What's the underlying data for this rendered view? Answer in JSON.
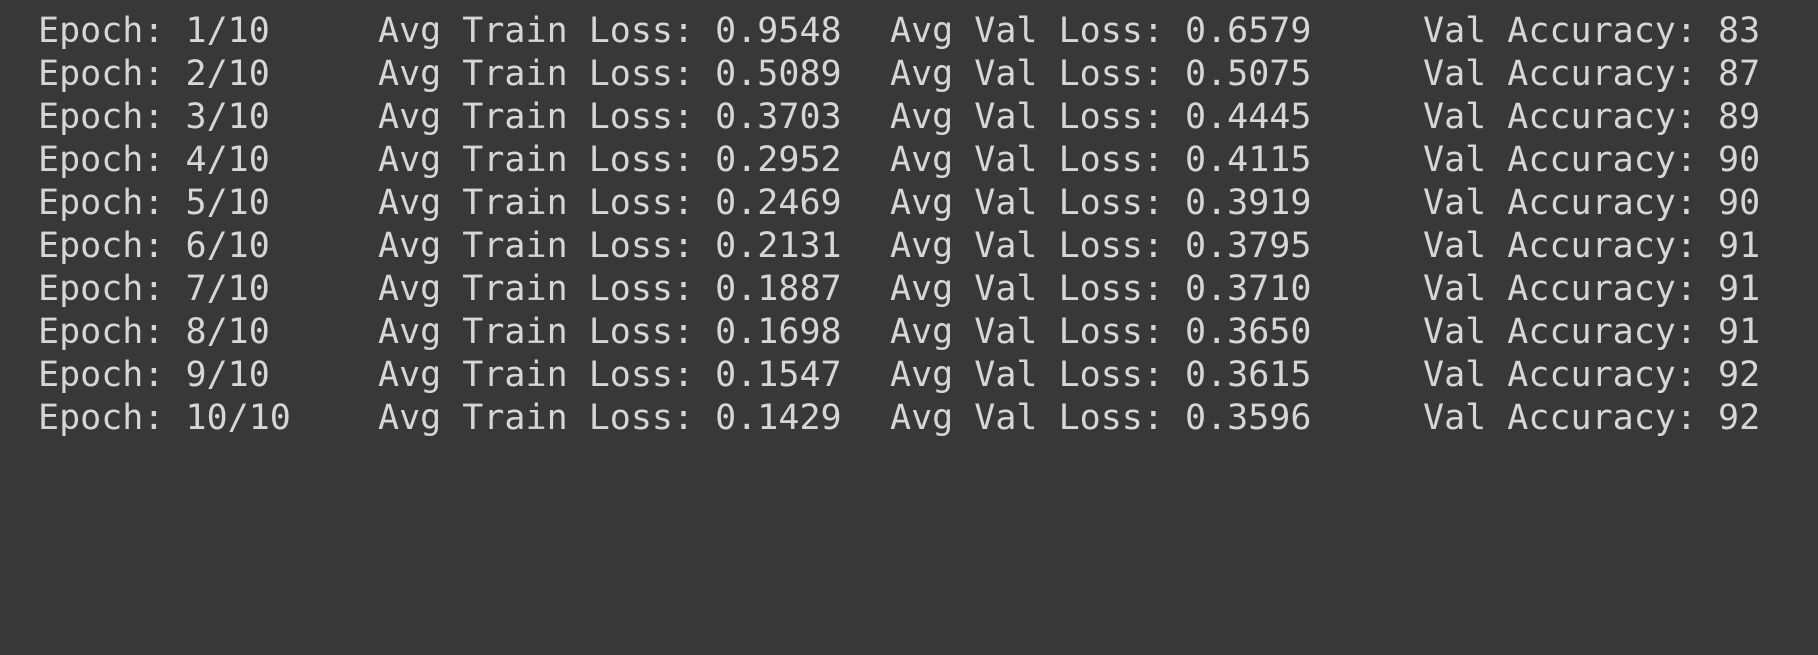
{
  "colors": {
    "background": "#383838",
    "text": "#d6d6d6"
  },
  "labels": {
    "epoch": "Epoch:",
    "train_loss": "Avg Train Loss:",
    "val_loss": "Avg Val Loss:",
    "val_accuracy": "Val Accuracy:"
  },
  "lines": [
    {
      "epoch": "1/10",
      "train_loss": "0.9548",
      "val_loss": "0.6579",
      "val_accuracy": "83"
    },
    {
      "epoch": "2/10",
      "train_loss": "0.5089",
      "val_loss": "0.5075",
      "val_accuracy": "87"
    },
    {
      "epoch": "3/10",
      "train_loss": "0.3703",
      "val_loss": "0.4445",
      "val_accuracy": "89"
    },
    {
      "epoch": "4/10",
      "train_loss": "0.2952",
      "val_loss": "0.4115",
      "val_accuracy": "90"
    },
    {
      "epoch": "5/10",
      "train_loss": "0.2469",
      "val_loss": "0.3919",
      "val_accuracy": "90"
    },
    {
      "epoch": "6/10",
      "train_loss": "0.2131",
      "val_loss": "0.3795",
      "val_accuracy": "91"
    },
    {
      "epoch": "7/10",
      "train_loss": "0.1887",
      "val_loss": "0.3710",
      "val_accuracy": "91"
    },
    {
      "epoch": "8/10",
      "train_loss": "0.1698",
      "val_loss": "0.3650",
      "val_accuracy": "91"
    },
    {
      "epoch": "9/10",
      "train_loss": "0.1547",
      "val_loss": "0.3615",
      "val_accuracy": "92"
    },
    {
      "epoch": "10/10",
      "train_loss": "0.1429",
      "val_loss": "0.3596",
      "val_accuracy": "92"
    }
  ]
}
